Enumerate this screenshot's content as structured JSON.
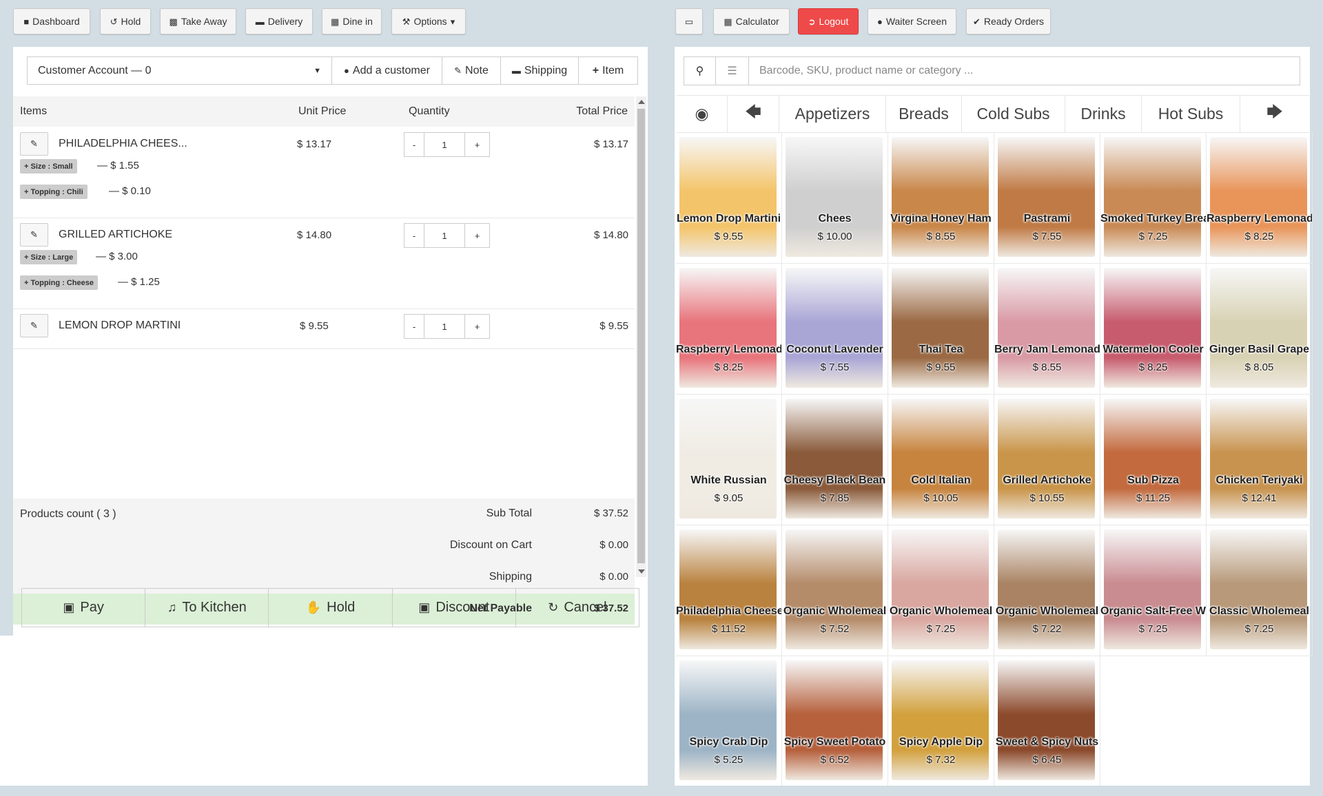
{
  "toolbar_left": [
    {
      "label": "Dashboard",
      "icon": "dashboard-icon"
    },
    {
      "label": "Hold",
      "icon": "history-icon"
    },
    {
      "label": "Take Away",
      "icon": "bag-icon"
    },
    {
      "label": "Delivery",
      "icon": "truck-icon"
    },
    {
      "label": "Dine in",
      "icon": "table-icon"
    },
    {
      "label": "Options",
      "icon": "wrench-icon"
    }
  ],
  "toolbar_right": [
    {
      "label": "",
      "icon": "window-icon"
    },
    {
      "label": "Calculator",
      "icon": "calculator-icon"
    },
    {
      "label": "Logout",
      "icon": "logout-icon"
    },
    {
      "label": "Waiter Screen",
      "icon": "user-icon"
    },
    {
      "label": "Ready Orders",
      "icon": "check-icon"
    }
  ],
  "account": {
    "customer": "Customer Account — 0",
    "add_customer": "Add a customer",
    "note": "Note",
    "shipping": "Shipping",
    "item": "Item"
  },
  "table_headers": {
    "items": "Items",
    "unit_price": "Unit Price",
    "quantity": "Quantity",
    "total_price": "Total Price"
  },
  "cart_items": [
    {
      "name": "PHILADELPHIA CHEES...",
      "unit": "$ 13.17",
      "qty": "1",
      "total": "$ 13.17",
      "options": [
        {
          "label": "+ Size : Small",
          "price": "— $ 1.55"
        },
        {
          "label": "+ Topping : Chili",
          "price": "— $ 0.10"
        }
      ]
    },
    {
      "name": "GRILLED ARTICHOKE",
      "unit": "$ 14.80",
      "qty": "1",
      "total": "$ 14.80",
      "options": [
        {
          "label": "+ Size : Large",
          "price": "— $ 3.00"
        },
        {
          "label": "+ Topping : Cheese",
          "price": "— $ 1.25"
        }
      ]
    },
    {
      "name": "LEMON DROP MARTINI",
      "unit": "$ 9.55",
      "qty": "1",
      "total": "$ 9.55",
      "options": []
    }
  ],
  "qty_controls": {
    "minus": "-",
    "plus": "+"
  },
  "summary": {
    "products_count": "Products count ( 3 )",
    "sub_total_label": "Sub Total",
    "sub_total": "$ 37.52",
    "discount_label": "Discount on Cart",
    "discount": "$ 0.00",
    "shipping_label": "Shipping",
    "shipping": "$ 0.00",
    "net_label": "Net Payable",
    "net": "$ 37.52"
  },
  "actions": [
    {
      "label": "Pay",
      "icon": "money-icon"
    },
    {
      "label": "To Kitchen",
      "icon": "utensils-icon"
    },
    {
      "label": "Hold",
      "icon": "hand-icon"
    },
    {
      "label": "Discount",
      "icon": "gift-icon"
    },
    {
      "label": "Cancel",
      "icon": "refresh-icon"
    }
  ],
  "search": {
    "placeholder": "Barcode, SKU, product name or category ..."
  },
  "categories": [
    "Appetizers",
    "Breads",
    "Cold Subs",
    "Drinks",
    "Hot Subs"
  ],
  "products": [
    {
      "name": "Lemon Drop Martini",
      "price": "$ 9.55",
      "color": "#f4c46a"
    },
    {
      "name": "Chees",
      "price": "$ 10.00",
      "color": "#cfcfcf"
    },
    {
      "name": "Virgina Honey Ham",
      "price": "$ 8.55",
      "color": "#c9874a"
    },
    {
      "name": "Pastrami",
      "price": "$ 7.55",
      "color": "#c07a45"
    },
    {
      "name": "Smoked Turkey Breast",
      "price": "$ 7.25",
      "color": "#c98a55"
    },
    {
      "name": "Raspberry Lemonade",
      "price": "$ 8.25",
      "color": "#e9955a"
    },
    {
      "name": "Raspberry Lemonade",
      "price": "$ 8.25",
      "color": "#e8747c"
    },
    {
      "name": "Coconut Lavender",
      "price": "$ 7.55",
      "color": "#a9a6d6"
    },
    {
      "name": "Thai Tea",
      "price": "$ 9.55",
      "color": "#9b6a44"
    },
    {
      "name": "Berry Jam Lemonade",
      "price": "$ 8.55",
      "color": "#d99aa5"
    },
    {
      "name": "Watermelon Cooler",
      "price": "$ 8.25",
      "color": "#c75c6e"
    },
    {
      "name": "Ginger Basil Grape",
      "price": "$ 8.05",
      "color": "#d8d2b4"
    },
    {
      "name": "White Russian",
      "price": "$ 9.05",
      "color": "#f0ece4"
    },
    {
      "name": "Cheesy Black Bean",
      "price": "$ 7.85",
      "color": "#8a5a3a"
    },
    {
      "name": "Cold Italian",
      "price": "$ 10.05",
      "color": "#c7843e"
    },
    {
      "name": "Grilled Artichoke",
      "price": "$ 10.55",
      "color": "#c9954a"
    },
    {
      "name": "Sub Pizza",
      "price": "$ 11.25",
      "color": "#c36a3e"
    },
    {
      "name": "Chicken Teriyaki",
      "price": "$ 12.41",
      "color": "#c8934f"
    },
    {
      "name": "Philadelphia Cheese",
      "price": "$ 11.52",
      "color": "#b9823f"
    },
    {
      "name": "Organic Wholemeal",
      "price": "$ 7.52",
      "color": "#b58c6a"
    },
    {
      "name": "Organic Wholemeal",
      "price": "$ 7.25",
      "color": "#d9a7a0"
    },
    {
      "name": "Organic Wholemeal",
      "price": "$ 7.22",
      "color": "#a98363"
    },
    {
      "name": "Organic Salt-Free Wholemeal",
      "price": "$ 7.25",
      "color": "#c98c91"
    },
    {
      "name": "Classic Wholemeal",
      "price": "$ 7.25",
      "color": "#b89a7a"
    },
    {
      "name": "Spicy Crab Dip",
      "price": "$ 5.25",
      "color": "#9db4c6"
    },
    {
      "name": "Spicy Sweet Potato",
      "price": "$ 6.52",
      "color": "#b6603c"
    },
    {
      "name": "Spicy Apple Dip",
      "price": "$ 7.32",
      "color": "#d2a13e"
    },
    {
      "name": "Sweet & Spicy Nuts",
      "price": "$ 6.45",
      "color": "#8c4a2c"
    }
  ]
}
